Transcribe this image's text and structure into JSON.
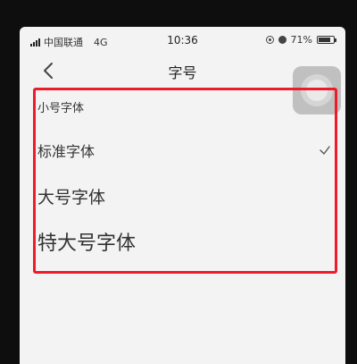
{
  "status_bar": {
    "carrier": "中国联通",
    "network": "4G",
    "time": "10:36",
    "battery": "71%"
  },
  "nav": {
    "title": "字号",
    "back_icon": "chevron-left-icon"
  },
  "font_options": [
    {
      "label": "小号字体",
      "selected": false
    },
    {
      "label": "标准字体",
      "selected": true
    },
    {
      "label": "大号字体",
      "selected": false
    },
    {
      "label": "特大号字体",
      "selected": false
    }
  ],
  "colors": {
    "highlight": "#ee1c2a",
    "background": "#f3f3f3"
  }
}
